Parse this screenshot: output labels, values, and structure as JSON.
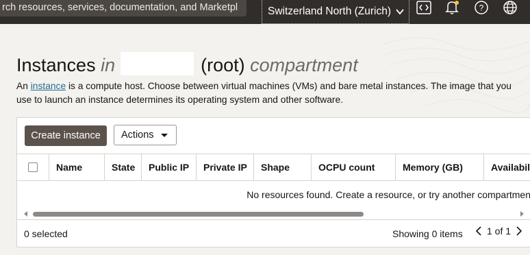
{
  "topbar": {
    "search_text": "rch resources, services, documentation, and Marketpl",
    "region_label": "Switzerland North (Zurich)",
    "icons": [
      "code-icon",
      "bell-icon",
      "help-icon",
      "globe-icon"
    ]
  },
  "page": {
    "title_main": "Instances",
    "title_in": "in",
    "title_root": "(root)",
    "title_compartment": "compartment",
    "desc_prefix": "An",
    "desc_link": "instance",
    "desc_rest": "is a compute host. Choose between virtual machines (VMs) and bare metal instances. The image that you use to launch an instance determines its operating system and other software."
  },
  "toolbar": {
    "create_label": "Create instance",
    "actions_label": "Actions"
  },
  "table": {
    "columns": [
      "Name",
      "State",
      "Public IP",
      "Private IP",
      "Shape",
      "OCPU count",
      "Memory (GB)",
      "Availabil"
    ],
    "empty_message": "No resources found. Create a resource, or try another compartmen"
  },
  "footer": {
    "selected": "0 selected",
    "showing": "Showing 0 items",
    "page_info": "1 of 1"
  },
  "colors": {
    "topbar": "#312d2a",
    "primary_button": "#5b524c",
    "link": "#1f6d94",
    "page_bg": "#f4f2ef"
  }
}
